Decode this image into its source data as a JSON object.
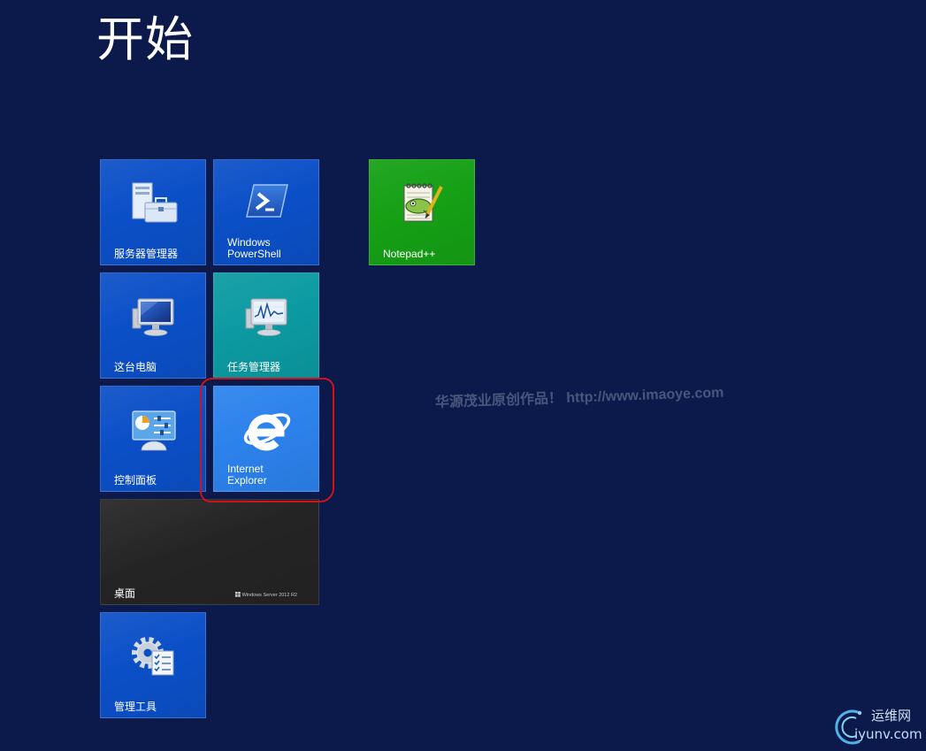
{
  "colors": {
    "background": "#0b1a4a"
  },
  "start_screen": {
    "title": "开始"
  },
  "tiles": {
    "server_manager": {
      "label": "服务器管理器",
      "icon": "server-manager-icon",
      "color": "#0b4fc7"
    },
    "powershell": {
      "label_line1": "Windows",
      "label_line2": "PowerShell",
      "icon": "powershell-icon",
      "color": "#0b4fc7"
    },
    "notepadpp": {
      "label": "Notepad++",
      "icon": "notepad-plus-plus-icon",
      "color": "#15a015"
    },
    "this_pc": {
      "label": "这台电脑",
      "icon": "computer-icon",
      "color": "#0b4fc7"
    },
    "task_manager": {
      "label": "任务管理器",
      "icon": "task-manager-icon",
      "color": "#0c9aa2"
    },
    "control_panel": {
      "label": "控制面板",
      "icon": "control-panel-icon",
      "color": "#0b4fc7"
    },
    "internet_explorer": {
      "label_line1": "Internet",
      "label_line2": "Explorer",
      "icon": "internet-explorer-icon",
      "color": "#2c82ec"
    },
    "desktop": {
      "label": "桌面",
      "branding": "Windows Server 2012 R2",
      "icon": "windows-logo-icon",
      "color": "#242424"
    },
    "admin_tools": {
      "label": "管理工具",
      "icon": "admin-tools-icon",
      "color": "#0b4fc7"
    }
  },
  "annotation": {
    "color": "#d0121b"
  },
  "watermark": {
    "text": "华源茂业原创作品！ http://www.imaoye.com"
  },
  "site_logo": {
    "name_cn": "运维网",
    "domain": "iyunv.com",
    "accent": "#4fb3e8"
  }
}
